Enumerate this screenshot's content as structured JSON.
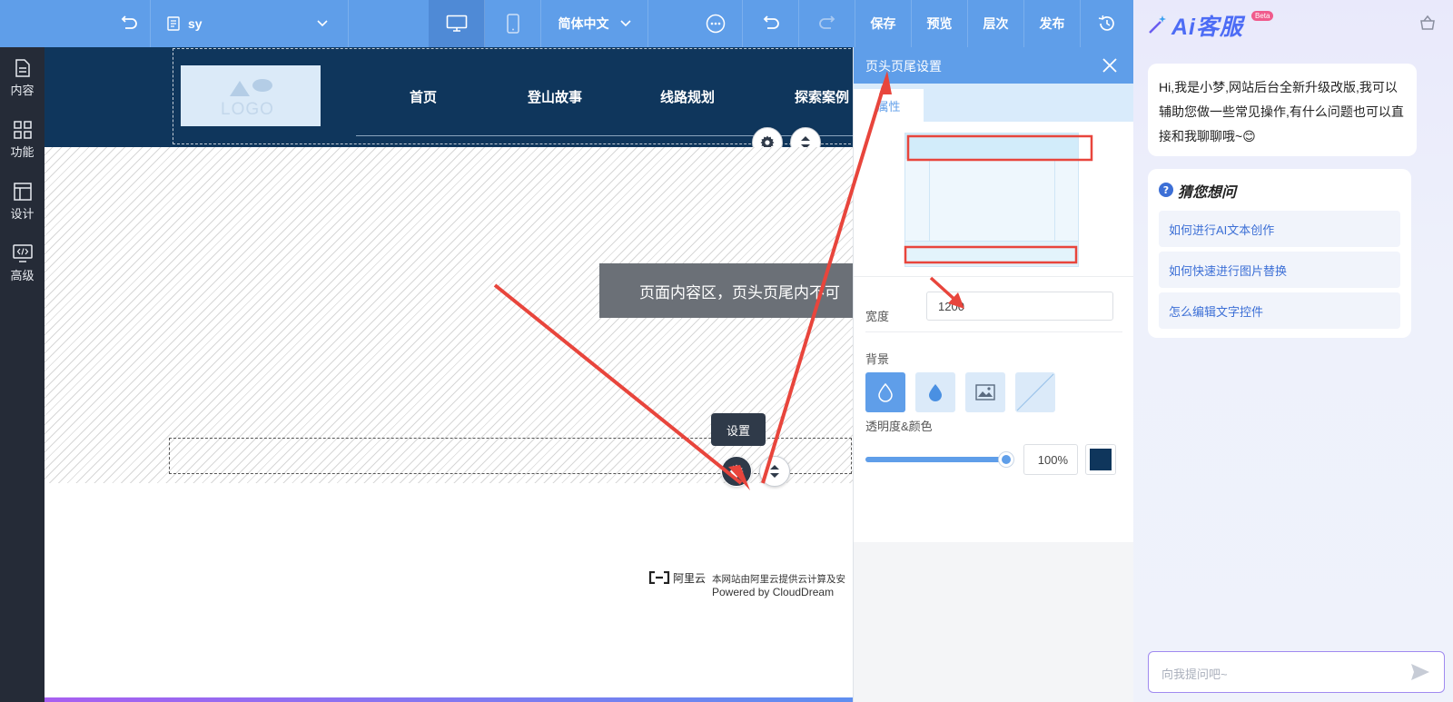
{
  "topbar": {
    "page_select_value": "sy",
    "language": "简体中文",
    "save_label": "保存",
    "preview_label": "预览",
    "layers_label": "层次",
    "publish_label": "发布"
  },
  "leftnav": {
    "items": [
      {
        "label": "内容",
        "icon": "document-icon"
      },
      {
        "label": "功能",
        "icon": "grid-icon"
      },
      {
        "label": "设计",
        "icon": "layout-icon"
      },
      {
        "label": "高级",
        "icon": "code-monitor-icon"
      }
    ]
  },
  "site": {
    "logo_text": "LOGO",
    "menu": [
      "首页",
      "登山故事",
      "线路规划",
      "探索案例"
    ],
    "content_notice": "页面内容区，页头页尾内不可",
    "tooltip": "设置",
    "footer_brand": "阿里云",
    "footer_line1": "本网站由阿里云提供云计算及安",
    "footer_line2": "Powered by CloudDream"
  },
  "panel": {
    "title": "页头页尾设置",
    "tab_label": "属性",
    "width_label": "宽度",
    "width_value": "1200",
    "background_label": "背景",
    "opacity_label": "透明度&颜色",
    "opacity_value": "100%",
    "opacity_fraction": 1.0,
    "color": "#0f365c"
  },
  "ai": {
    "title": "Ai客服",
    "badge": "Beta",
    "greeting": "Hi,我是小梦,网站后台全新升级改版,我可以辅助您做一些常见操作,有什么问题也可以直接和我聊聊哦~😊",
    "suggest_title": "猜您想问",
    "questions": [
      "如何进行AI文本创作",
      "如何快速进行图片替换",
      "怎么编辑文字控件"
    ],
    "input_placeholder": "向我提问吧~"
  },
  "colors": {
    "accent": "#5f9ee9",
    "nav_bg": "#252b37",
    "header_bg": "#0f365c",
    "annotation_red": "#e8453c"
  }
}
